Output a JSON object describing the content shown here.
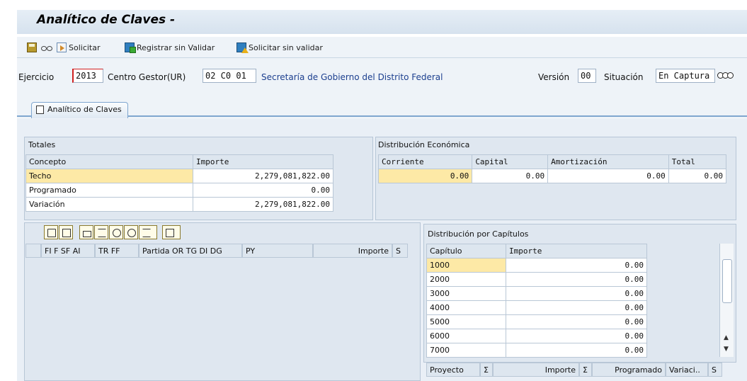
{
  "title": "Analítico de Claves -",
  "toolbar": {
    "solicitar": "Solicitar",
    "registrar": "Registrar sin Validar",
    "solicitar_sin": "Solicitar sin validar"
  },
  "header": {
    "ejercicio_label": "Ejercicio",
    "ejercicio_value": "2013",
    "centro_label": "Centro Gestor(UR)",
    "centro_value": "02 C0 01",
    "centro_descr": "Secretaría de Gobierno del Distrito Federal",
    "version_label": "Versión",
    "version_value": "00",
    "situacion_label": "Situación",
    "situacion_value": "En Captura"
  },
  "tab": {
    "label": "Analítico de Claves"
  },
  "totales": {
    "title": "Totales",
    "col_concepto": "Concepto",
    "col_importe": "Importe",
    "rows": [
      {
        "concepto": "Techo",
        "importe": "2,279,081,822.00"
      },
      {
        "concepto": "Programado",
        "importe": "0.00"
      },
      {
        "concepto": "Variación",
        "importe": "2,279,081,822.00"
      }
    ]
  },
  "distrib_econ": {
    "title": "Distribución Económica",
    "headers": [
      "Corriente",
      "Capital",
      "Amortización",
      "Total"
    ],
    "values": [
      "0.00",
      "0.00",
      "0.00",
      "0.00"
    ]
  },
  "claves_grid": {
    "headers": [
      "FI F SF AI",
      "TR  FF",
      "Partida OR TG DI DG",
      "PY",
      "Importe",
      "S"
    ]
  },
  "capitulos": {
    "title": "Distribución por Capítulos",
    "col_capitulo": "Capítulo",
    "col_importe": "Importe",
    "rows": [
      {
        "capitulo": "1000",
        "importe": "0.00"
      },
      {
        "capitulo": "2000",
        "importe": "0.00"
      },
      {
        "capitulo": "3000",
        "importe": "0.00"
      },
      {
        "capitulo": "4000",
        "importe": "0.00"
      },
      {
        "capitulo": "5000",
        "importe": "0.00"
      },
      {
        "capitulo": "6000",
        "importe": "0.00"
      },
      {
        "capitulo": "7000",
        "importe": "0.00"
      }
    ]
  },
  "proyecto_grid": {
    "headers": [
      "Proyecto",
      "Σ",
      "Importe",
      "Σ",
      "Programado",
      "Variaci..",
      "S"
    ]
  }
}
